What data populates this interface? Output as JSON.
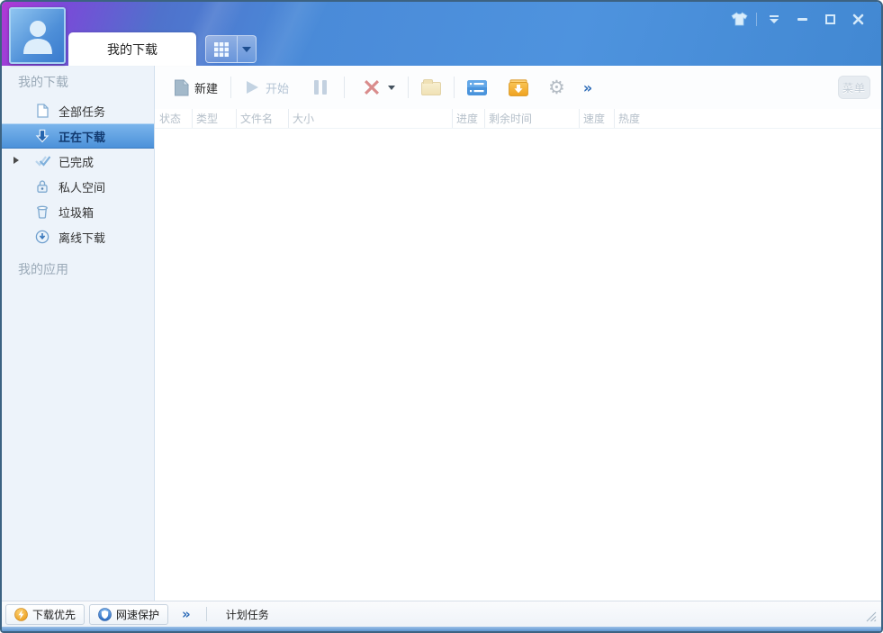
{
  "header": {
    "tab_label": "我的下载"
  },
  "sidebar": {
    "section_downloads": "我的下载",
    "section_apps": "我的应用",
    "items": [
      {
        "label": "全部任务",
        "icon": "document-icon",
        "selected": false
      },
      {
        "label": "正在下载",
        "icon": "download-arrow-icon",
        "selected": true
      },
      {
        "label": "已完成",
        "icon": "double-check-icon",
        "selected": false,
        "expandable": true
      },
      {
        "label": "私人空间",
        "icon": "lock-icon",
        "selected": false
      },
      {
        "label": "垃圾箱",
        "icon": "trash-icon",
        "selected": false
      },
      {
        "label": "离线下载",
        "icon": "offline-download-icon",
        "selected": false
      }
    ]
  },
  "toolbar": {
    "new_label": "新建",
    "start_label": "开始",
    "gear_glyph": "⚙",
    "more_glyph": "»",
    "menu_label": "菜单"
  },
  "table": {
    "columns": [
      {
        "label": "状态"
      },
      {
        "label": "类型"
      },
      {
        "label": "文件名"
      },
      {
        "label": "大小"
      },
      {
        "label": "进度"
      },
      {
        "label": "剩余时间"
      },
      {
        "label": "速度"
      },
      {
        "label": "热度"
      }
    ],
    "rows": []
  },
  "statusbar": {
    "download_priority_label": "下载优先",
    "speed_protection_label": "网速保护",
    "more_glyph": "»",
    "scheduled_tasks_label": "计划任务"
  },
  "icons": {
    "window": [
      "skin-tshirt-icon",
      "main-menu-icon",
      "minimize-icon",
      "maximize-icon",
      "close-icon"
    ],
    "toolbar": [
      "new-document-icon",
      "play-icon",
      "pause-icon",
      "delete-x-icon",
      "folder-icon",
      "list-view-icon",
      "download-box-icon",
      "gear-icon"
    ],
    "statusbar": [
      "lightning-circle-icon",
      "shield-circle-icon",
      "resize-grip-icon"
    ]
  },
  "colors": {
    "titlebar_purple": "#b138d6",
    "titlebar_blue": "#4a8ad8",
    "selected_item_top": "#7cb6ec",
    "selected_item_bottom": "#4a90d9",
    "accent_blue": "#2e6cb8",
    "delete_red": "#d98c8c",
    "box_orange": "#efa21f",
    "priority_orange": "#e8940f",
    "protect_blue": "#2a6ac0",
    "sidebar_bg": "#edf3fa"
  }
}
